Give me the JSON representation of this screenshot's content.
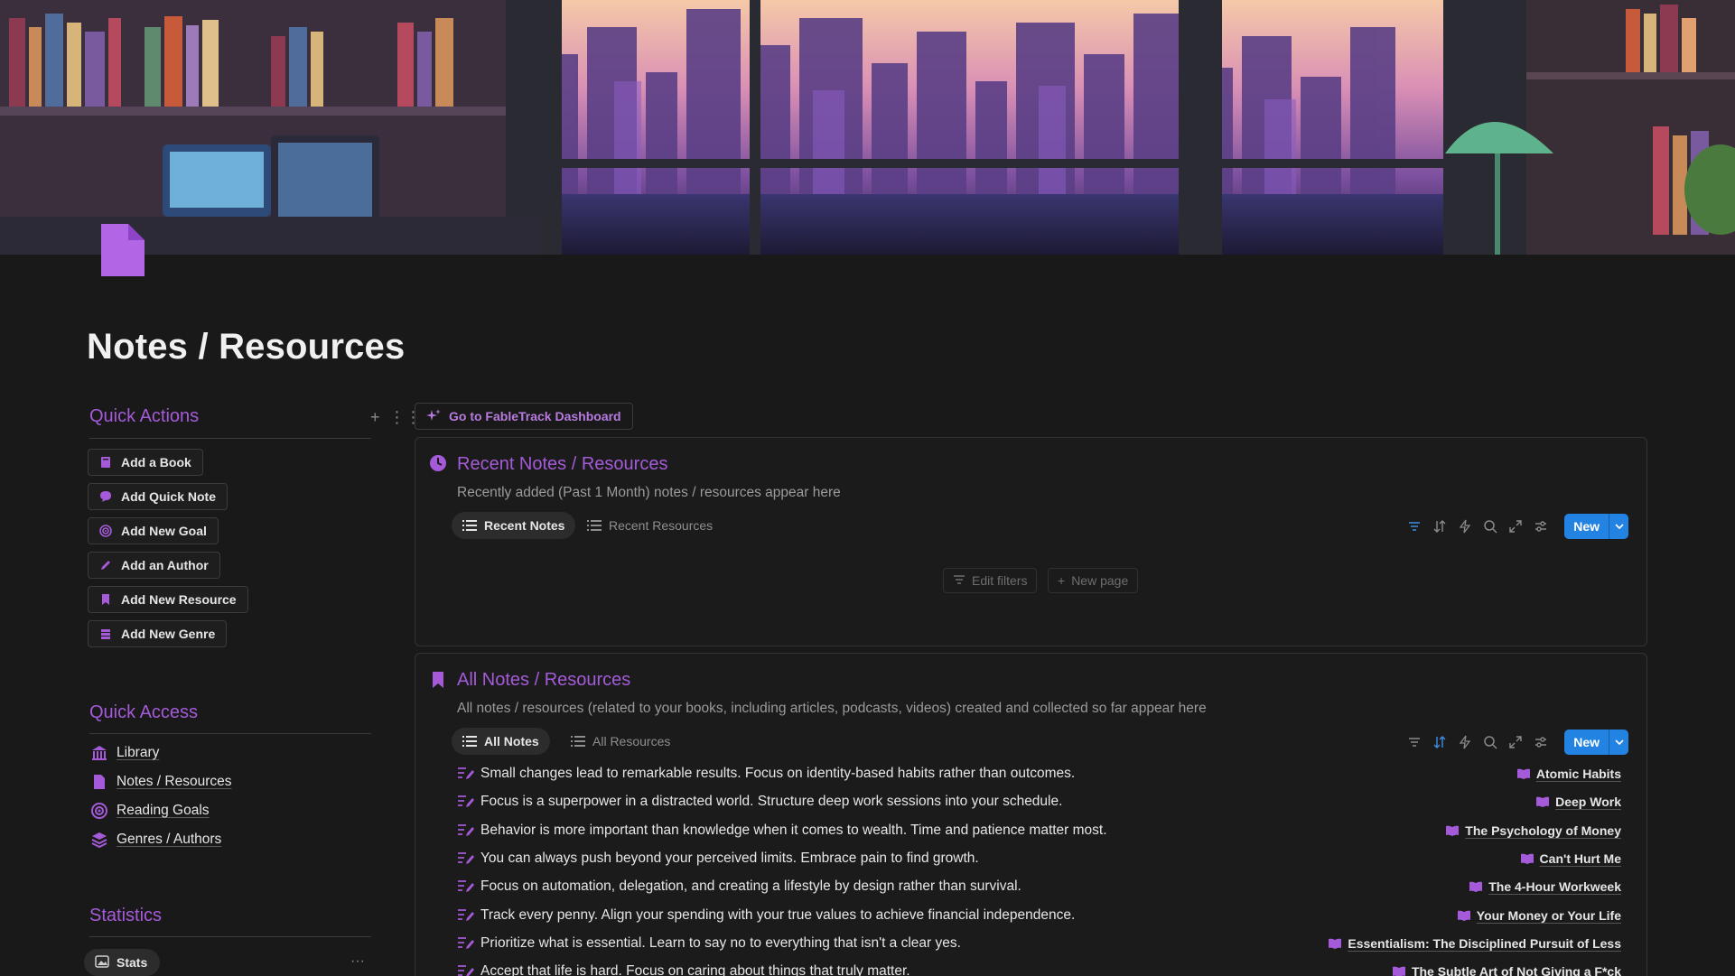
{
  "page": {
    "title": "Notes / Resources"
  },
  "quick_actions": {
    "heading": "Quick Actions",
    "buttons": [
      {
        "label": "Add a Book",
        "icon": "book-icon"
      },
      {
        "label": "Add Quick Note",
        "icon": "chat-bubble-icon"
      },
      {
        "label": "Add New Goal",
        "icon": "target-icon"
      },
      {
        "label": "Add an Author",
        "icon": "pen-icon"
      },
      {
        "label": "Add New Resource",
        "icon": "bookmark-icon"
      },
      {
        "label": "Add New Genre",
        "icon": "books-stack-icon"
      }
    ]
  },
  "quick_access": {
    "heading": "Quick Access",
    "items": [
      {
        "label": "Library",
        "icon": "library-icon"
      },
      {
        "label": "Notes / Resources",
        "icon": "document-icon"
      },
      {
        "label": "Reading Goals",
        "icon": "target-icon"
      },
      {
        "label": "Genres / Authors",
        "icon": "layers-icon"
      }
    ]
  },
  "statistics": {
    "heading": "Statistics",
    "tab_label": "Stats"
  },
  "dashboard_link": {
    "label": "Go to FableTrack Dashboard"
  },
  "recent_panel": {
    "title": "Recent Notes / Resources",
    "description": "Recently added (Past 1 Month) notes / resources appear here",
    "tabs": [
      "Recent Notes",
      "Recent Resources"
    ],
    "new_label": "New",
    "empty_actions": [
      "Edit filters",
      "New page"
    ]
  },
  "all_panel": {
    "title": "All Notes / Resources",
    "description": "All notes / resources (related to your books, including articles, podcasts, videos) created and collected so far appear here",
    "tabs": [
      "All Notes",
      "All Resources"
    ],
    "new_label": "New",
    "rows": [
      {
        "note": "Small changes lead to remarkable results. Focus on identity-based habits rather than outcomes.",
        "book": "Atomic Habits"
      },
      {
        "note": "Focus is a superpower in a distracted world. Structure deep work sessions into your schedule.",
        "book": "Deep Work"
      },
      {
        "note": "Behavior is more important than knowledge when it comes to wealth. Time and patience matter most.",
        "book": "The Psychology of Money"
      },
      {
        "note": "You can always push beyond your perceived limits. Embrace pain to find growth.",
        "book": "Can't Hurt Me"
      },
      {
        "note": "Focus on automation, delegation, and creating a lifestyle by design rather than survival.",
        "book": "The 4-Hour Workweek"
      },
      {
        "note": "Track every penny. Align your spending with your true values to achieve financial independence.",
        "book": "Your Money or Your Life"
      },
      {
        "note": "Prioritize what is essential. Learn to say no to everything that isn't a clear yes.",
        "book": "Essentialism: The Disciplined Pursuit of Less"
      },
      {
        "note": "Accept that life is hard. Focus on caring about things that truly matter.",
        "book": "The Subtle Art of Not Giving a F*ck"
      }
    ]
  },
  "colors": {
    "accent": "#a55bd9",
    "primary_button": "#2383e2",
    "background": "#191919"
  }
}
